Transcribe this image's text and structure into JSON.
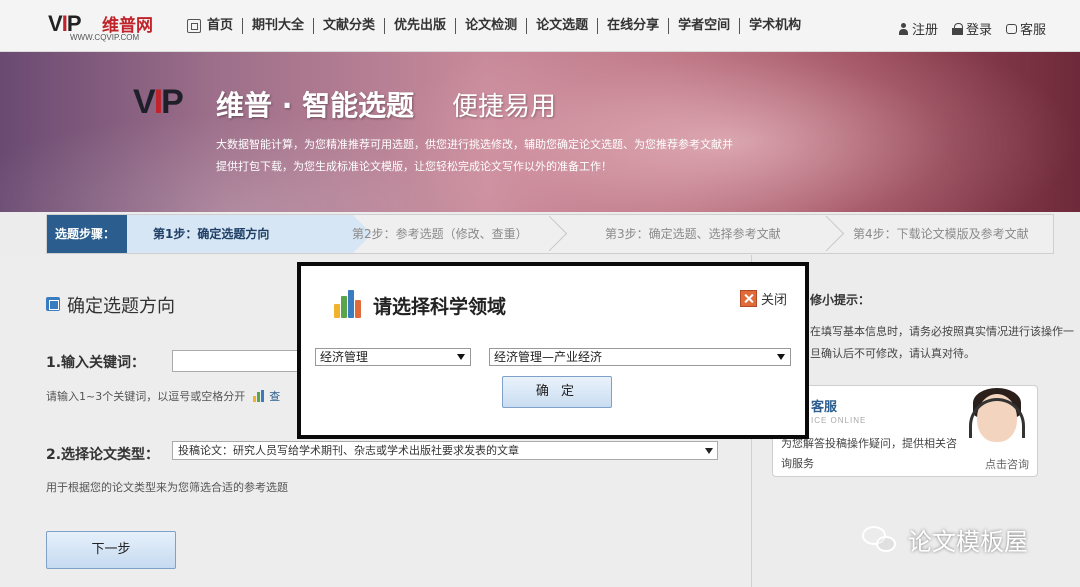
{
  "header": {
    "logo_mark": "VIP",
    "logo_cn": "维普网",
    "logo_url": "WWW.CQVIP.COM",
    "nav": [
      "首页",
      "期刊大全",
      "文献分类",
      "优先出版",
      "论文检测",
      "论文选题",
      "在线分享",
      "学者空间",
      "学术机构"
    ],
    "register": "注册",
    "login": "登录",
    "service": "客服"
  },
  "banner": {
    "logo": "VIP",
    "title": "维普 · 智能选题",
    "subtitle": "便捷易用",
    "desc": "大数据智能计算，为您精准推荐可用选题，供您进行挑选修改，辅助您确定论文选题、为您推荐参考文献并提供打包下载，为您生成标准论文模版，让您轻松完成论文写作以外的准备工作！"
  },
  "steps": {
    "label": "选题步骤：",
    "items": [
      "第1步：确定选题方向",
      "第2步：参考选题（修改、查重）",
      "第3步：确定选题、选择参考文献",
      "第4步：下载论文模版及参考文献"
    ]
  },
  "form": {
    "section_title": "确定选题方向",
    "keyword_label": "1.输入关键词：",
    "keyword_hint": "请输入1~3个关键词，以逗号或空格分开",
    "keyword_link": "查",
    "type_label": "2.选择论文类型：",
    "type_value": "投稿论文：研究人员写给学术期刊、杂志或学术出版社要求发表的文章",
    "type_hint": "用于根据您的论文类型来为您筛选合适的参考选题",
    "next": "下一步"
  },
  "tips": {
    "title": "修小提示：",
    "text": "在填写基本信息时，请务必按照真实情况进行该操作一旦确认后不可修改，请认真对待。"
  },
  "service_box": {
    "title": "客服",
    "en": "ICE ONLINE",
    "text": "为您解答投稿操作疑问，提供相关咨询服务",
    "link": "点击咨询"
  },
  "dialog": {
    "title": "请选择科学领域",
    "close": "关闭",
    "field1": "经济管理",
    "field2": "经济管理—产业经济",
    "ok": "确 定"
  },
  "watermark": {
    "text": "论文模板屋"
  },
  "colors": {
    "step_active": "#2b5e8e",
    "bar_colors": [
      "#f0b32b",
      "#5aa54a",
      "#3a7cc0",
      "#e06a3a"
    ]
  }
}
